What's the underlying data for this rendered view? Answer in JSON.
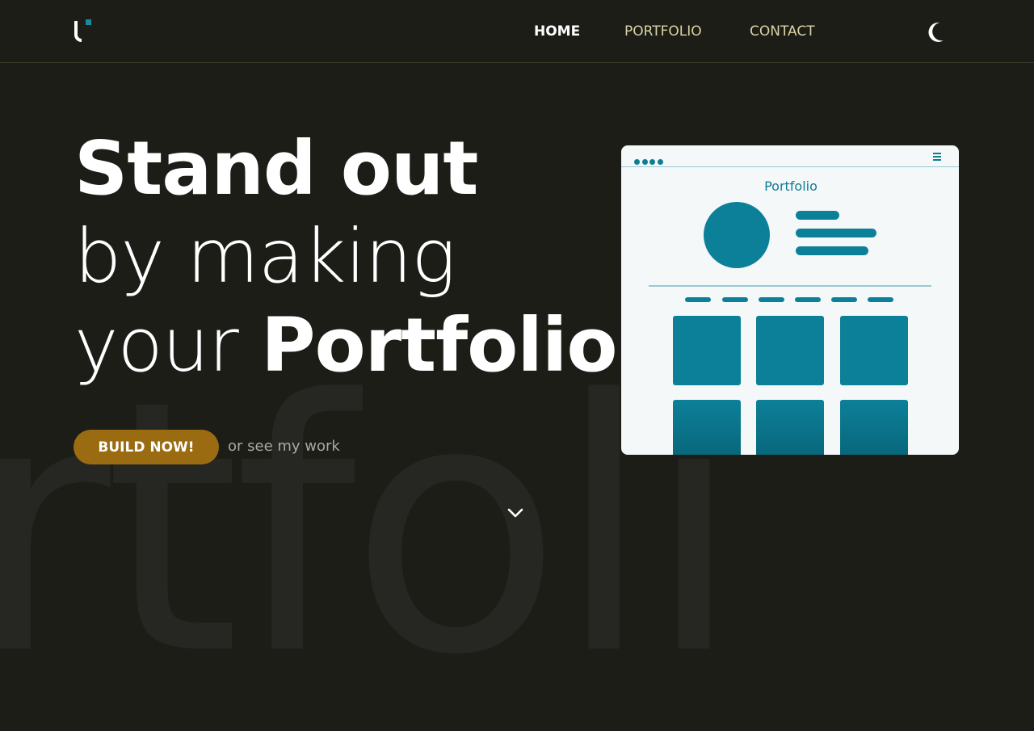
{
  "background_word": "rtfoli",
  "nav": {
    "items": [
      {
        "label": "HOME",
        "active": true
      },
      {
        "label": "PORTFOLIO",
        "active": false
      },
      {
        "label": "CONTACT",
        "active": false
      }
    ],
    "theme_toggle_icon": "moon-icon"
  },
  "hero": {
    "line1": "Stand out",
    "line2": "by making",
    "line3_light": "your ",
    "line3_bold": "Portfolio."
  },
  "cta": {
    "button_label": "BUILD NOW!",
    "secondary_link": "or see my work"
  },
  "mockup": {
    "title": "Portfolio"
  },
  "icons": {
    "logo": "logo-icon",
    "scroll": "chevron-down-icon",
    "menu": "hamburger-menu-icon"
  },
  "colors": {
    "background": "#1c1d17",
    "accent_teal": "#0c8099",
    "button_gold": "#9a6b11",
    "nav_text": "#d9d3a4"
  }
}
